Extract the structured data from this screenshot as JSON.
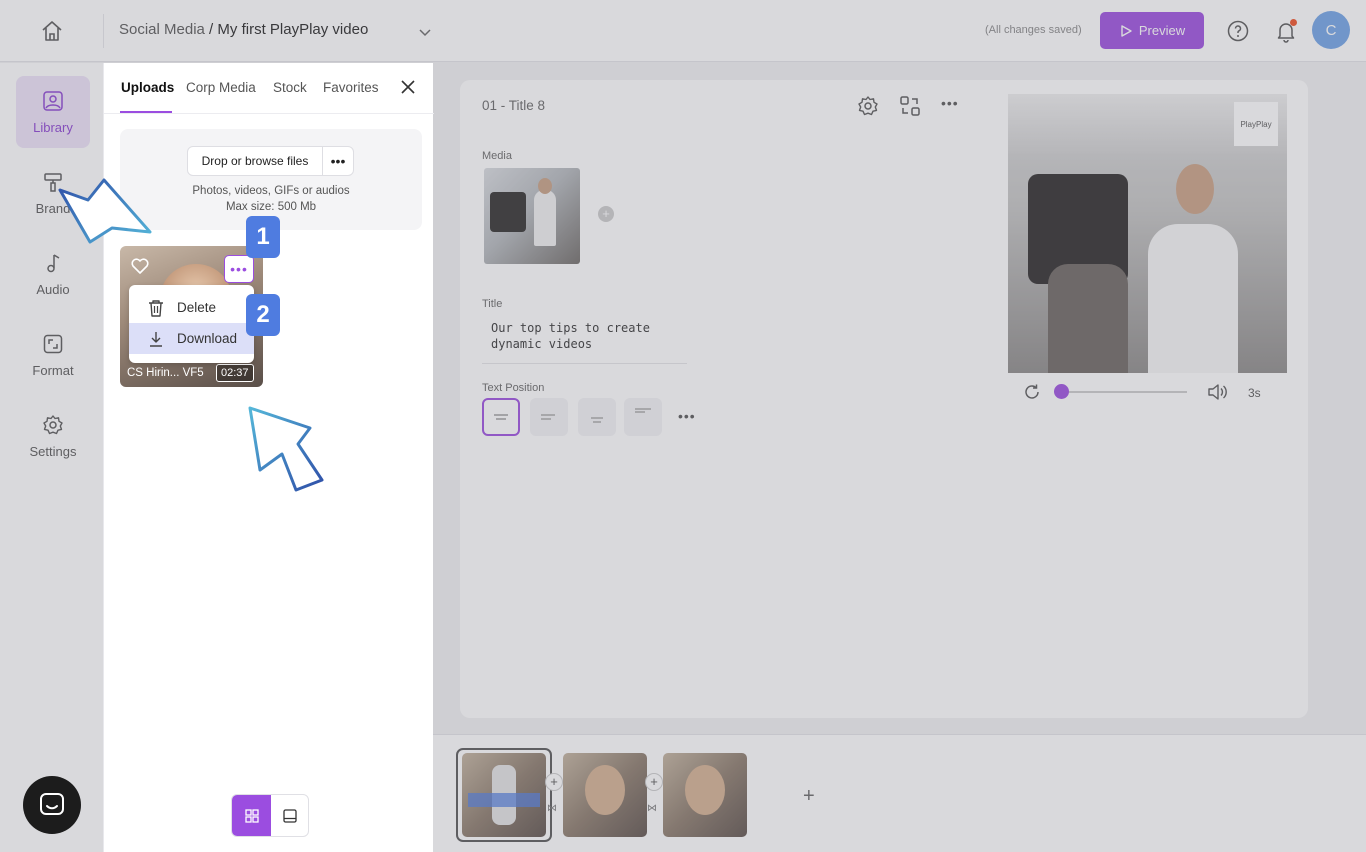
{
  "topbar": {
    "breadcrumb_parent": "Social Media",
    "breadcrumb_sep": " / ",
    "project_name": "My first PlayPlay video",
    "save_status": "(All changes saved)",
    "preview_label": "Preview",
    "avatar_initial": "C",
    "accent_color": "#9b4de0"
  },
  "leftnav": {
    "items": [
      {
        "label": "Library",
        "icon": "image-icon",
        "active": true
      },
      {
        "label": "Brand",
        "icon": "paint-roller-icon"
      },
      {
        "label": "Audio",
        "icon": "music-note-icon"
      },
      {
        "label": "Format",
        "icon": "resize-icon"
      },
      {
        "label": "Settings",
        "icon": "gear-icon"
      }
    ]
  },
  "library": {
    "tabs": [
      {
        "label": "Uploads",
        "active": true
      },
      {
        "label": "Corp Media"
      },
      {
        "label": "Stock"
      },
      {
        "label": "Favorites"
      }
    ],
    "browse_label": "Drop or browse files",
    "browse_more": "•••",
    "hint_line1": "Photos, videos, GIFs or audios",
    "hint_line2": "Max size: 500 Mb",
    "asset": {
      "name": "CS Hirin... VF5",
      "duration": "02:37",
      "more": "•••"
    },
    "menu": {
      "delete_label": "Delete",
      "download_label": "Download"
    },
    "badges": {
      "step1": "1",
      "step2": "2"
    }
  },
  "editor": {
    "slide_title": "01 - Title 8",
    "media_label": "Media",
    "title_label": "Title",
    "title_line1": "Our top tips to create",
    "title_line2": "dynamic videos",
    "text_position_label": "Text Position",
    "text_position_more": "•••",
    "more": "•••",
    "preview_logo": "PlayPlay",
    "player_duration": "3s",
    "player_progress": 0.0
  },
  "timeline": {
    "add_label": "+"
  }
}
